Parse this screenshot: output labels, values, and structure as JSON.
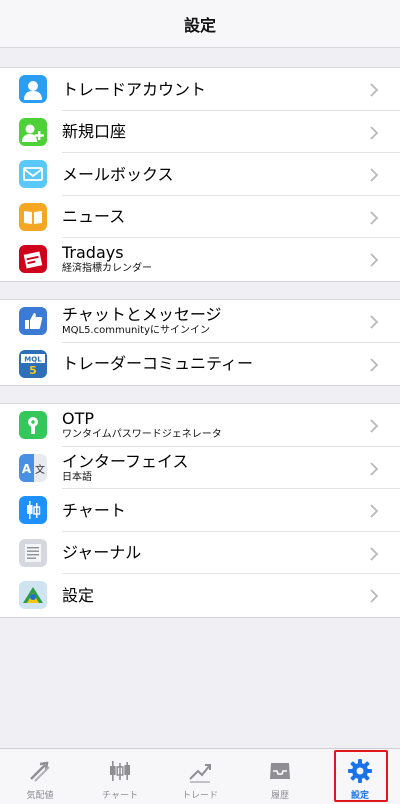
{
  "header": {
    "title": "設定"
  },
  "groups": [
    {
      "items": [
        {
          "label": "トレードアカウント",
          "sub": "",
          "icon": "account-icon",
          "color": "#2a9df4"
        },
        {
          "label": "新規口座",
          "sub": "",
          "icon": "new-account-icon",
          "color": "#4cd137"
        },
        {
          "label": "メールボックス",
          "sub": "",
          "icon": "mail-icon",
          "color": "#5ac8fa"
        },
        {
          "label": "ニュース",
          "sub": "",
          "icon": "news-book-icon",
          "color": "#f5a623"
        },
        {
          "label": "Tradays",
          "sub": "経済指標カレンダー",
          "icon": "tradays-calendar-icon",
          "color": "#d0021b"
        }
      ]
    },
    {
      "items": [
        {
          "label": "チャットとメッセージ",
          "sub": "MQL5.communityにサインイン",
          "icon": "thumbs-up-icon",
          "color": "#3b7bd6"
        },
        {
          "label": "トレーダーコミュニティー",
          "sub": "",
          "icon": "mql5-icon",
          "color": "#2d6fb8"
        }
      ]
    },
    {
      "items": [
        {
          "label": "OTP",
          "sub": "ワンタイムパスワードジェネレータ",
          "icon": "keyhole-icon",
          "color": "#34c759"
        },
        {
          "label": "インターフェイス",
          "sub": "日本語",
          "icon": "translate-icon",
          "color": "#e8eaf0"
        },
        {
          "label": "チャート",
          "sub": "",
          "icon": "candlestick-icon",
          "color": "#1e90ff"
        },
        {
          "label": "ジャーナル",
          "sub": "",
          "icon": "journal-icon",
          "color": "#d5d8de"
        },
        {
          "label": "設定",
          "sub": "",
          "icon": "metatrader-icon",
          "color": "#cfe3f1"
        }
      ]
    }
  ],
  "tabs": [
    {
      "label": "気配値",
      "icon": "quotes-arrows-icon",
      "active": false
    },
    {
      "label": "チャート",
      "icon": "chart-candles-icon",
      "active": false
    },
    {
      "label": "トレード",
      "icon": "trade-trend-icon",
      "active": false
    },
    {
      "label": "履歴",
      "icon": "history-inbox-icon",
      "active": false
    },
    {
      "label": "設定",
      "icon": "settings-gear-icon",
      "active": true
    }
  ],
  "colors": {
    "accent": "#1a73e8",
    "tabInactive": "#8e8e93",
    "highlight": "#e0161d"
  }
}
